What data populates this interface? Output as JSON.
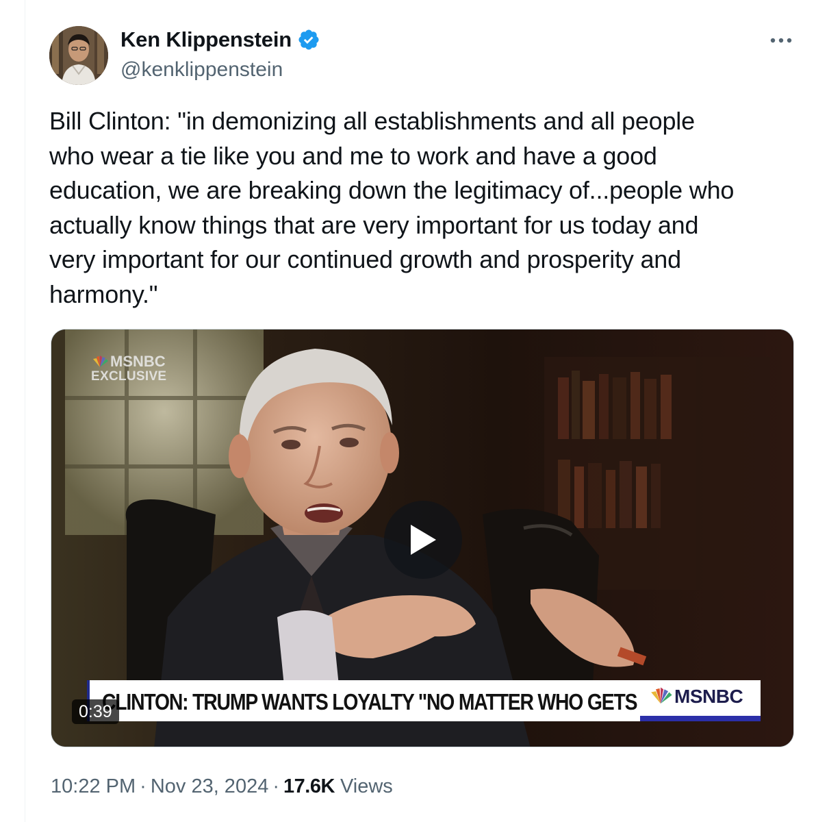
{
  "author": {
    "display_name": "Ken Klippenstein",
    "handle": "@kenklippenstein",
    "verified": true
  },
  "tweet": {
    "text": "Bill Clinton: \"in demonizing all establishments and all people\nwho wear a tie like you and me to work and have a good\neducation, we are breaking down the legitimacy of...people who\nactually know things that are very important for us today and\nvery important for our continued growth and prosperity and\nharmony.\""
  },
  "media": {
    "bug_line1": "MSNBC",
    "bug_line2": "EXCLUSIVE",
    "lower_third_headline": "CLINTON: TRUMP WANTS LOYALTY \"NO MATTER WHO GETS HURT\"",
    "lower_third_logo": "MSNBC",
    "duration": "0:39"
  },
  "meta": {
    "time": "10:22 PM",
    "separator": "·",
    "date": "Nov 23, 2024",
    "views_count": "17.6K",
    "views_label": "Views"
  },
  "colors": {
    "verified_blue": "#1d9bf0",
    "secondary_text": "#536471",
    "primary_text": "#0f1419"
  },
  "icons": {
    "verified": "verified-badge-icon",
    "more": "more-horizontal-icon",
    "play": "play-icon",
    "peacock": "nbc-peacock-icon"
  }
}
